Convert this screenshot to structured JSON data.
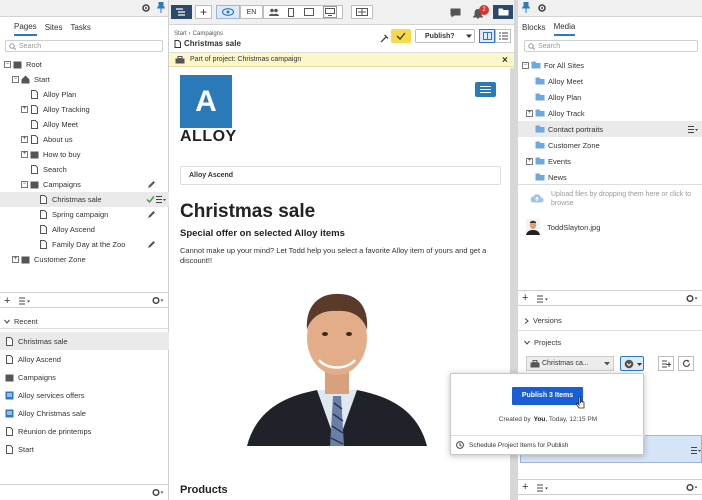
{
  "left": {
    "tabs": [
      "Pages",
      "Sites",
      "Tasks"
    ],
    "search_placeholder": "Search",
    "tree": [
      {
        "label": "Root"
      },
      {
        "label": "Start"
      },
      {
        "label": "Alloy Plan"
      },
      {
        "label": "Alloy Tracking"
      },
      {
        "label": "Alloy Meet"
      },
      {
        "label": "About us"
      },
      {
        "label": "How to buy"
      },
      {
        "label": "Search"
      },
      {
        "label": "Campaigns"
      },
      {
        "label": "Christmas sale"
      },
      {
        "label": "Spring campaign"
      },
      {
        "label": "Alloy Ascend"
      },
      {
        "label": "Family Day at the Zoo"
      },
      {
        "label": "Customer Zone"
      }
    ],
    "recent_title": "Recent",
    "recent": [
      {
        "label": "Christmas sale"
      },
      {
        "label": "Alloy Ascend"
      },
      {
        "label": "Campaigns"
      },
      {
        "label": "Alloy services offers"
      },
      {
        "label": "Alloy Christmas sale"
      },
      {
        "label": "Réunion de printemps"
      },
      {
        "label": "Start"
      }
    ]
  },
  "toolbar": {
    "lang": "EN",
    "notification_count": "2",
    "breadcrumb_1": "Start",
    "breadcrumb_2": "Campaigns",
    "page_title": "Christmas sale",
    "publish_label": "Publish?",
    "project_notice": "Part of project: Christmas campaign"
  },
  "page": {
    "logo_letter": "A",
    "logo_word": "Alloy",
    "nav_item": "Alloy Ascend",
    "heading": "Christmas sale",
    "subheading": "Special offer on selected Alloy items",
    "body": "Cannot make up your mind? Let Todd help you select a favorite Alloy item of yours and get a discount!!",
    "products": "Products"
  },
  "right": {
    "tabs": [
      "Blocks",
      "Media"
    ],
    "search_placeholder": "Search",
    "folders": [
      {
        "label": "For All Sites"
      },
      {
        "label": "Alloy Meet"
      },
      {
        "label": "Alloy Plan"
      },
      {
        "label": "Alloy Track"
      },
      {
        "label": "Contact portraits"
      },
      {
        "label": "Customer Zone"
      },
      {
        "label": "Events"
      },
      {
        "label": "News"
      }
    ],
    "upload_hint": "Upload files by dropping them here or click to browse",
    "file_name": "ToddSlayton.jpg",
    "versions": "Versions",
    "projects": "Projects",
    "project_select": "Christmas ca..."
  },
  "flyout": {
    "publish_button": "Publish 3 Items",
    "created_by_prefix": "Created by",
    "created_by_user": "You",
    "created_by_suffix": ", Today, 12:15 PM",
    "schedule": "Schedule Project Items for Publish"
  },
  "colors": {
    "accent": "#2f78c4",
    "publish": "#1a5ed6",
    "notice": "#fdf6c9",
    "logo": "#2a79b8"
  }
}
